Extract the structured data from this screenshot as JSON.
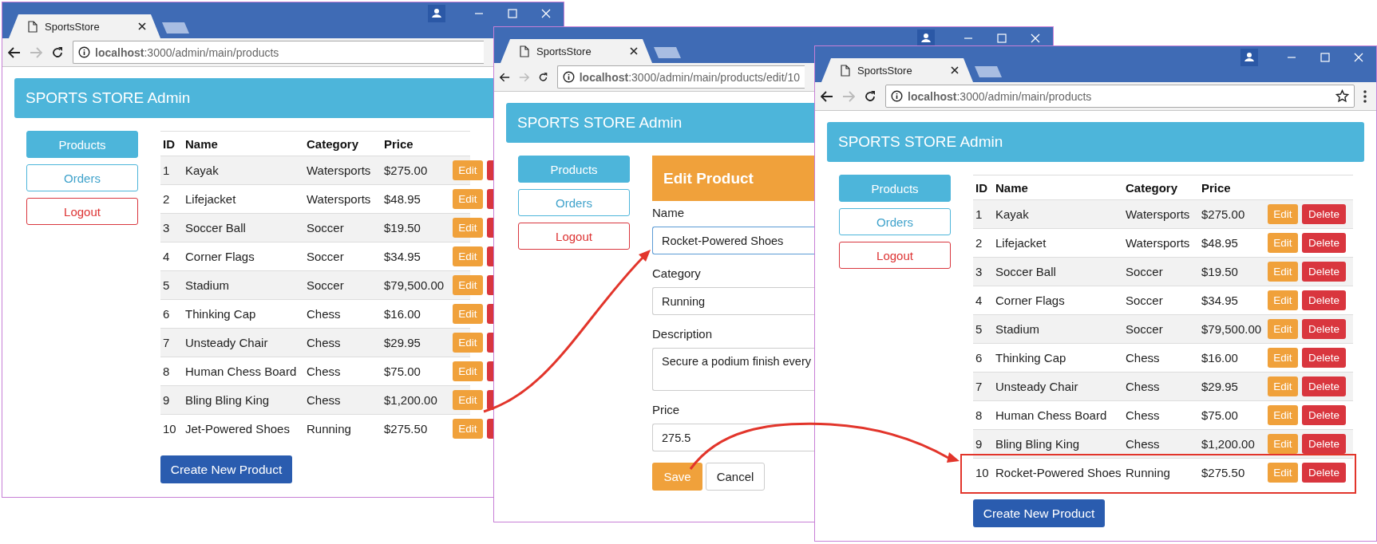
{
  "windows": [
    {
      "partly_covered": true,
      "tab": {
        "title": "SportsStore"
      },
      "address": "**localhost**:3000/admin/main/products",
      "brand": "SPORTS STORE Admin",
      "nav": [
        {
          "label": "Products",
          "selected": true,
          "kind": "info"
        },
        {
          "label": "Orders",
          "selected": false,
          "kind": "info"
        },
        {
          "label": "Logout",
          "selected": false,
          "kind": "danger"
        }
      ],
      "view": {
        "kind": "table",
        "columns": [
          "ID",
          "Name",
          "Category",
          "Price"
        ],
        "rows": [
          {
            "id": "1",
            "name": "Kayak",
            "category": "Watersports",
            "price": "$275.00",
            "actions": [
              {
                "kind": "edit",
                "label": "Edit"
              },
              {
                "kind": "delete"
              }
            ]
          },
          {
            "id": "2",
            "name": "Lifejacket",
            "category": "Watersports",
            "price": "$48.95",
            "actions": [
              {
                "kind": "edit",
                "label": "Edit"
              },
              {
                "kind": "delete"
              }
            ]
          },
          {
            "id": "3",
            "name": "Soccer Ball",
            "category": "Soccer",
            "price": "$19.50",
            "actions": [
              {
                "kind": "edit",
                "label": "Edit"
              },
              {
                "kind": "delete"
              }
            ]
          },
          {
            "id": "4",
            "name": "Corner Flags",
            "category": "Soccer",
            "price": "$34.95",
            "actions": [
              {
                "kind": "edit",
                "label": "Edit"
              },
              {
                "kind": "delete"
              }
            ]
          },
          {
            "id": "5",
            "name": "Stadium",
            "category": "Soccer",
            "price": "$79,500.00",
            "actions": [
              {
                "kind": "edit",
                "label": "Edit"
              },
              {
                "kind": "delete"
              }
            ]
          },
          {
            "id": "6",
            "name": "Thinking Cap",
            "category": "Chess",
            "price": "$16.00",
            "actions": [
              {
                "kind": "edit",
                "label": "Edit"
              },
              {
                "kind": "delete"
              }
            ]
          },
          {
            "id": "7",
            "name": "Unsteady Chair",
            "category": "Chess",
            "price": "$29.95",
            "actions": [
              {
                "kind": "edit",
                "label": "Edit"
              },
              {
                "kind": "delete"
              }
            ]
          },
          {
            "id": "8",
            "name": "Human Chess Board",
            "category": "Chess",
            "price": "$75.00",
            "actions": [
              {
                "kind": "edit",
                "label": "Edit"
              },
              {
                "kind": "delete"
              }
            ]
          },
          {
            "id": "9",
            "name": "Bling Bling King",
            "category": "Chess",
            "price": "$1,200.00",
            "actions": [
              {
                "kind": "edit",
                "label": "Edit"
              },
              {
                "kind": "delete"
              }
            ]
          },
          {
            "id": "10",
            "name": "Jet-Powered Shoes",
            "category": "Running",
            "price": "$275.50",
            "actions": [
              {
                "kind": "edit",
                "label": "Edit"
              },
              {
                "kind": "delete"
              }
            ]
          }
        ],
        "create_button": "Create New Product"
      }
    },
    {
      "partly_covered": true,
      "tab": {
        "title": "SportsStore"
      },
      "address": "**localhost**:3000/admin/main/products/edit/10",
      "brand": "SPORTS STORE Admin",
      "nav": [
        {
          "label": "Products",
          "selected": true,
          "kind": "info"
        },
        {
          "label": "Orders",
          "selected": false,
          "kind": "info"
        },
        {
          "label": "Logout",
          "selected": false,
          "kind": "danger"
        }
      ],
      "view": {
        "kind": "form",
        "title": "Edit Product",
        "fields": [
          {
            "kind": "input",
            "label": "Name",
            "value": "Rocket-Powered Shoes",
            "focused": true
          },
          {
            "kind": "input",
            "label": "Category",
            "value": "Running",
            "focused": false
          },
          {
            "kind": "textarea",
            "label": "Description",
            "value": "Secure a podium finish every",
            "focused": false
          },
          {
            "kind": "input",
            "label": "Price",
            "value": "275.5",
            "focused": false
          }
        ],
        "buttons": [
          {
            "kind": "save",
            "label": "Save"
          },
          {
            "kind": "cancel",
            "label": "Cancel"
          }
        ]
      }
    },
    {
      "partly_covered": false,
      "tab": {
        "title": "SportsStore"
      },
      "address": "**localhost**:3000/admin/main/products",
      "brand": "SPORTS STORE Admin",
      "nav": [
        {
          "label": "Products",
          "selected": true,
          "kind": "info"
        },
        {
          "label": "Orders",
          "selected": false,
          "kind": "info"
        },
        {
          "label": "Logout",
          "selected": false,
          "kind": "danger"
        }
      ],
      "view": {
        "kind": "table",
        "columns": [
          "ID",
          "Name",
          "Category",
          "Price"
        ],
        "rows": [
          {
            "id": "1",
            "name": "Kayak",
            "category": "Watersports",
            "price": "$275.00",
            "highlighted": false,
            "actions": [
              {
                "kind": "edit",
                "label": "Edit"
              },
              {
                "kind": "delete",
                "label": "Delete"
              }
            ]
          },
          {
            "id": "2",
            "name": "Lifejacket",
            "category": "Watersports",
            "price": "$48.95",
            "highlighted": false,
            "actions": [
              {
                "kind": "edit",
                "label": "Edit"
              },
              {
                "kind": "delete",
                "label": "Delete"
              }
            ]
          },
          {
            "id": "3",
            "name": "Soccer Ball",
            "category": "Soccer",
            "price": "$19.50",
            "highlighted": false,
            "actions": [
              {
                "kind": "edit",
                "label": "Edit"
              },
              {
                "kind": "delete",
                "label": "Delete"
              }
            ]
          },
          {
            "id": "4",
            "name": "Corner Flags",
            "category": "Soccer",
            "price": "$34.95",
            "highlighted": false,
            "actions": [
              {
                "kind": "edit",
                "label": "Edit"
              },
              {
                "kind": "delete",
                "label": "Delete"
              }
            ]
          },
          {
            "id": "5",
            "name": "Stadium",
            "category": "Soccer",
            "price": "$79,500.00",
            "highlighted": false,
            "actions": [
              {
                "kind": "edit",
                "label": "Edit"
              },
              {
                "kind": "delete",
                "label": "Delete"
              }
            ]
          },
          {
            "id": "6",
            "name": "Thinking Cap",
            "category": "Chess",
            "price": "$16.00",
            "highlighted": false,
            "actions": [
              {
                "kind": "edit",
                "label": "Edit"
              },
              {
                "kind": "delete",
                "label": "Delete"
              }
            ]
          },
          {
            "id": "7",
            "name": "Unsteady Chair",
            "category": "Chess",
            "price": "$29.95",
            "highlighted": false,
            "actions": [
              {
                "kind": "edit",
                "label": "Edit"
              },
              {
                "kind": "delete",
                "label": "Delete"
              }
            ]
          },
          {
            "id": "8",
            "name": "Human Chess Board",
            "category": "Chess",
            "price": "$75.00",
            "highlighted": false,
            "actions": [
              {
                "kind": "edit",
                "label": "Edit"
              },
              {
                "kind": "delete",
                "label": "Delete"
              }
            ]
          },
          {
            "id": "9",
            "name": "Bling Bling King",
            "category": "Chess",
            "price": "$1,200.00",
            "highlighted": false,
            "actions": [
              {
                "kind": "edit",
                "label": "Edit"
              },
              {
                "kind": "delete",
                "label": "Delete"
              }
            ]
          },
          {
            "id": "10",
            "name": "Rocket-Powered Shoes",
            "category": "Running",
            "price": "$275.50",
            "highlighted": true,
            "actions": [
              {
                "kind": "edit",
                "label": "Edit"
              },
              {
                "kind": "delete",
                "label": "Delete"
              }
            ]
          }
        ],
        "create_button": "Create New Product"
      }
    }
  ]
}
